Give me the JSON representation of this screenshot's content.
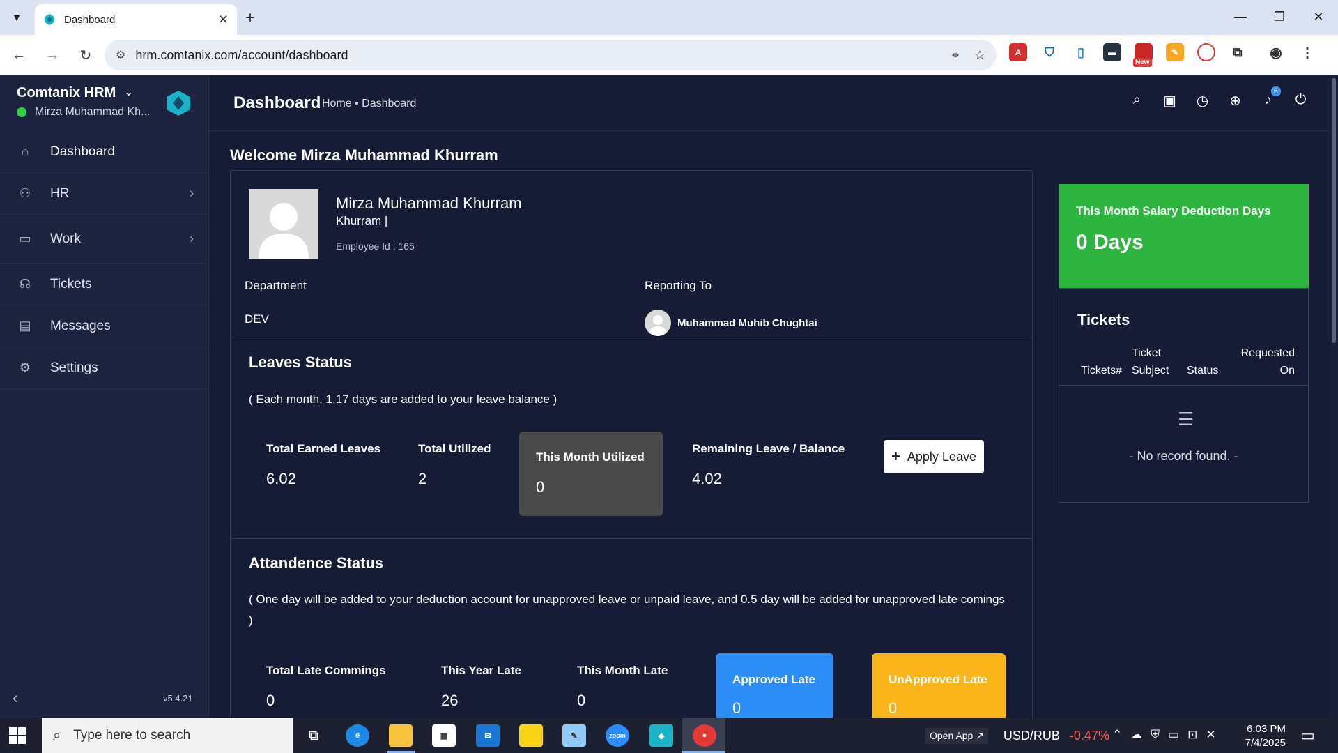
{
  "browser": {
    "tab_title": "Dashboard",
    "url": "hrm.comtanix.com/account/dashboard",
    "ext_new_badge": "New"
  },
  "sidebar": {
    "brand": "Comtanix HRM",
    "user": "Mirza Muhammad Kh...",
    "items": [
      {
        "label": "Dashboard",
        "icon": "home-icon"
      },
      {
        "label": "HR",
        "icon": "users-icon"
      },
      {
        "label": "Work",
        "icon": "briefcase-icon"
      },
      {
        "label": "Tickets",
        "icon": "headset-icon"
      },
      {
        "label": "Messages",
        "icon": "message-icon"
      },
      {
        "label": "Settings",
        "icon": "gear-icon"
      }
    ],
    "version": "v5.4.21"
  },
  "header": {
    "title": "Dashboard",
    "breadcrumb": "Home • Dashboard",
    "notification_count": "6"
  },
  "welcome": "Welcome Mirza Muhammad Khurram",
  "profile": {
    "name": "Mirza Muhammad Khurram",
    "short": "Khurram |",
    "employee_id": "Employee Id : 165",
    "department_label": "Department",
    "department": "DEV",
    "reporting_label": "Reporting To",
    "reporting_to": "Muhammad Muhib Chughtai"
  },
  "leaves": {
    "title": "Leaves Status",
    "note": "( Each month, 1.17 days are added to your leave balance )",
    "total_earned_label": "Total Earned Leaves",
    "total_earned": "6.02",
    "total_utilized_label": "Total Utilized",
    "total_utilized": "2",
    "month_utilized_label": "This Month Utilized",
    "month_utilized": "0",
    "remaining_label": "Remaining Leave / Balance",
    "remaining": "4.02",
    "apply_button": "Apply Leave"
  },
  "attendance": {
    "title": "Attandence Status",
    "note": "( One day will be added to your deduction account for unapproved leave or unpaid leave, and 0.5 day will be added for unapproved late comings )",
    "total_late_label": "Total Late Commings",
    "total_late": "0",
    "year_late_label": "This Year Late",
    "year_late": "26",
    "month_late_label": "This Month Late",
    "month_late": "0",
    "approved_label": "Approved Late",
    "approved": "0",
    "unapproved_label": "UnApproved Late",
    "unapproved": "0"
  },
  "salary": {
    "title": "This Month Salary Deduction Days",
    "value": "0 Days"
  },
  "tickets": {
    "title": "Tickets",
    "col_number": "Tickets#",
    "col_subject_1": "Ticket",
    "col_subject_2": "Subject",
    "col_status": "Status",
    "col_requested_1": "Requested",
    "col_requested_2": "On",
    "empty": "- No record found. -"
  },
  "taskbar": {
    "search_placeholder": "Type here to search",
    "open_app": "Open App ↗",
    "ticker": "USD/RUB",
    "ticker_change": "-0.47%",
    "time": "6:03 PM",
    "date": "7/4/2025",
    "zoom_label": "zoom"
  },
  "colors": {
    "sidebar_bg": "#1d2440",
    "main_bg": "#161c35",
    "salary_green": "#2db53f",
    "approved_blue": "#2b8df5",
    "unapproved_yellow": "#f9b51a",
    "month_utilized_gray": "#4a4a4a"
  }
}
